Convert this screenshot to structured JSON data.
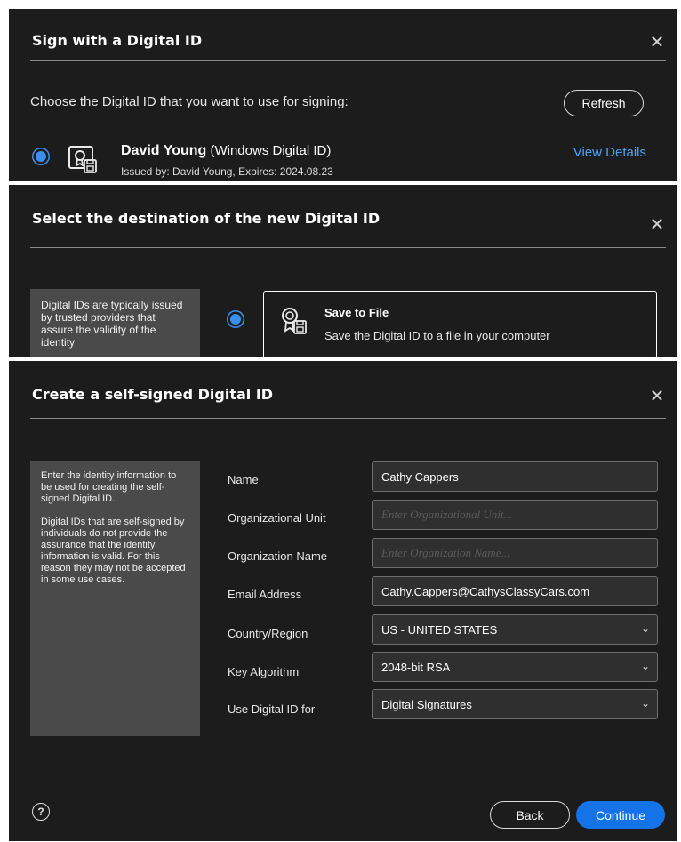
{
  "sign_dialog": {
    "title": "Sign with a Digital ID",
    "close_icon": "close-icon",
    "prompt": "Choose the Digital ID that you want to use for signing:",
    "refresh_label": "Refresh",
    "id_name": "David Young",
    "id_type": "(Windows Digital ID)",
    "issued": "Issued by: David Young, Expires: 2024.08.23",
    "view_details": "View Details"
  },
  "destination_dialog": {
    "title": "Select the destination of the new Digital ID",
    "info": "Digital IDs are typically issued by trusted providers that assure the validity of the identity",
    "option_title": "Save to File",
    "option_desc": "Save the Digital ID to a file in your computer"
  },
  "create_dialog": {
    "title": "Create a self-signed Digital ID",
    "info_p1": "Enter the identity information to be used for creating the self-signed Digital ID.",
    "info_p2": "Digital IDs that are self-signed by individuals do not provide the assurance that the identity information is valid. For this reason they may not be accepted in some use cases.",
    "fields": {
      "name_label": "Name",
      "name_value": "Cathy Cappers",
      "org_unit_label": "Organizational Unit",
      "org_unit_placeholder": "Enter Organizational Unit...",
      "org_name_label": "Organization Name",
      "org_name_placeholder": "Enter Organization Name...",
      "email_label": "Email Address",
      "email_value": "Cathy.Cappers@CathysClassyCars.com",
      "country_label": "Country/Region",
      "country_value": "US - UNITED STATES",
      "algo_label": "Key Algorithm",
      "algo_value": "2048-bit RSA",
      "use_label": "Use Digital ID for",
      "use_value": "Digital Signatures"
    },
    "help_glyph": "?",
    "back_label": "Back",
    "continue_label": "Continue"
  },
  "colors": {
    "panel_bg": "#1c1c1c",
    "accent": "#1473e6",
    "link": "#4aa3f7",
    "radio": "#3b8ff0",
    "info_bg": "#4a4a4a"
  }
}
